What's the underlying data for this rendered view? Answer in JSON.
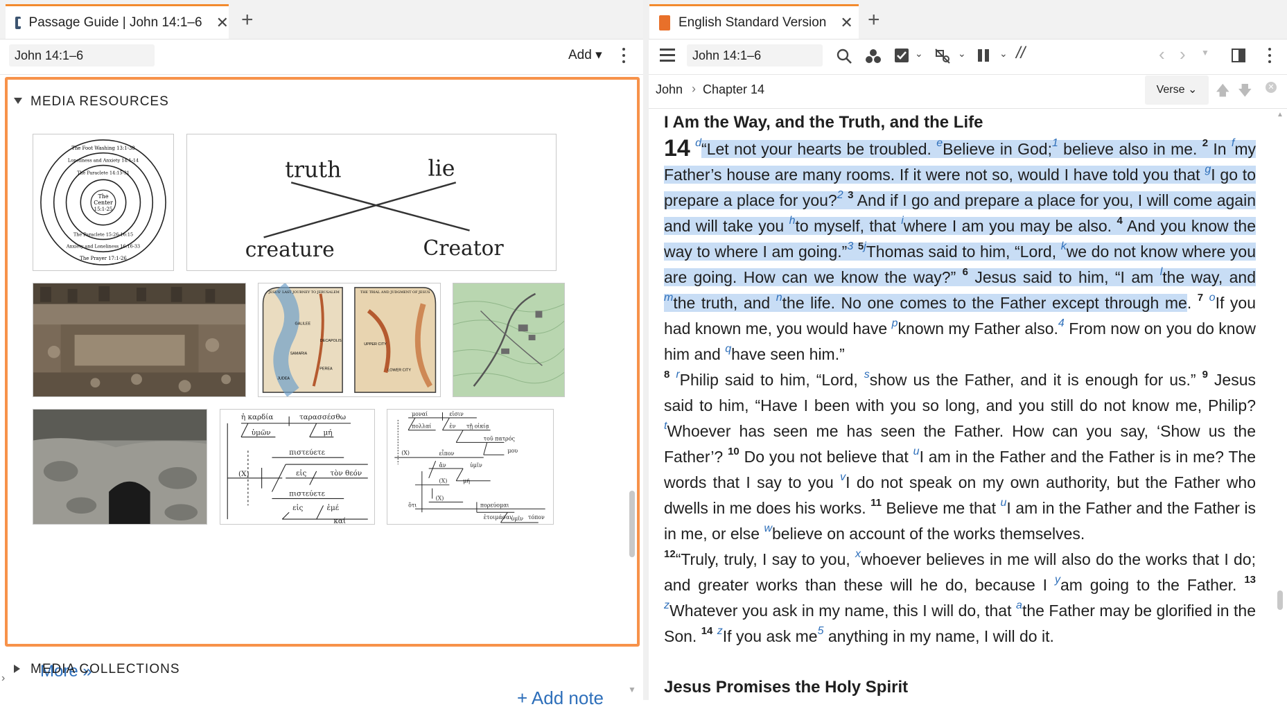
{
  "left": {
    "tab": {
      "title": "Passage Guide | John 14:1–6",
      "close": "✕",
      "add": "+"
    },
    "reference": "John 14:1–6",
    "add_button": "Add ▾",
    "media_resources": {
      "title": "MEDIA RESOURCES",
      "thumb1": {
        "ring_labels": [
          "The Foot Washing 13:1-38",
          "Loneliness and Anxiety 14:1-14",
          "The Paraclete 14:15-31",
          "The Paraclete 15:26-16:15",
          "Anxiety and Loneliness 16:16-33",
          "The Prayer 17:1-26"
        ],
        "center": [
          "The",
          "Center",
          "15:1-25"
        ]
      },
      "thumb2": {
        "words": [
          "truth",
          "lie",
          "creature",
          "Creator"
        ]
      },
      "thumb4": {
        "left_title": "JESUS' LAST JOURNEY TO JERUSALEM",
        "right_title": "THE TRIAL AND JUDGMENT OF JESUS",
        "places": [
          "GALILEE",
          "SAMARIA",
          "DECAPOLIS",
          "JUDEA",
          "PEREA",
          "UPPER CITY",
          "LOWER CITY"
        ]
      },
      "thumb7": {
        "words": [
          "ἡ καρδία",
          "ταρασσέσθω",
          "ὑμῶν",
          "μή",
          "πιστεύετε",
          "(X)",
          "εἰς",
          "τὸν θεόν",
          "πιστεύετε",
          "εἰς",
          "ἐμέ",
          "καί"
        ]
      },
      "thumb8": {
        "words": [
          "μοναί",
          "εἰσιν",
          "πολλαί",
          "ἐν",
          "τῇ οἰκίᾳ",
          "τοῦ πατρός",
          "μου",
          "(X)",
          "εἶπον",
          "ἄν",
          "ὑμῖν",
          "(X)",
          "μή",
          "ὅτι",
          "(X)",
          "πορεύομαι",
          "ἑτοιμάσαι",
          "τόπον",
          "ὑμῖν"
        ]
      },
      "more": "More »",
      "add_note": "+ Add note"
    },
    "media_collections": {
      "title": "MEDIA COLLECTIONS"
    }
  },
  "right": {
    "tab": {
      "title": "English Standard Version",
      "close": "✕",
      "add": "+"
    },
    "reference": "John 14:1–6",
    "breadcrumb": {
      "book": "John",
      "sep": "›",
      "chapter": "Chapter 14"
    },
    "verse_button": "Verse ⌄",
    "heading1": "I Am the Way, and the Truth, and the Life",
    "heading2": "Jesus Promises the Holy Spirit",
    "chapter_number": "14",
    "verses": {
      "v1_cr_d": "d",
      "v1_a": "“Let not your hearts be troubled. ",
      "v1_cr_e": "e",
      "v1_b": "Believe in God;",
      "v1_fn": "1",
      "v1_c": " believe also in me. ",
      "v2_num": "2",
      "v2_a": " In ",
      "v2_cr_f": "f",
      "v2_b": "my Father’s house are many rooms. If it were not so, would I have told you that ",
      "v2_cr_g": "g",
      "v2_c": "I go to prepare a place for you?",
      "v2_fn": "2",
      "v3_num": "3",
      "v3_a": " And if I go and prepare a place for you, I will come again and will take you ",
      "v3_cr_h": "h",
      "v3_b": "to myself, that ",
      "v3_cr_i": "i",
      "v3_c": "where I am you may be also. ",
      "v4_num": "4",
      "v4_a": " And you know the way to where I am going.”",
      "v4_fn": "3",
      "v5_num": "5",
      "v5_cr_j": "j",
      "v5_a": "Thomas said to him, “Lord, ",
      "v5_cr_k": "k",
      "v5_b": "we do not know where you are going. How can we know the way?” ",
      "v6_num": "6",
      "v6_a": " Jesus said to him, “I am ",
      "v6_cr_l": "l",
      "v6_b": "the way, and ",
      "v6_cr_m": "m",
      "v6_c": "the truth, and ",
      "v6_cr_n": "n",
      "v6_d": "the life. No one comes to the Father except through me",
      "v6_end": ". ",
      "v7_num": "7",
      "v7_cr_o": "o",
      "v7_a": "If you had known me, you would have ",
      "v7_cr_p": "p",
      "v7_b": "known my Father also.",
      "v7_fn": "4",
      "v7_c": " From now on you do know him and ",
      "v7_cr_q": "q",
      "v7_d": "have seen him.”",
      "v8_num": "8",
      "v8_cr_r": "r",
      "v8_a": "Philip said to him, “Lord, ",
      "v8_cr_s": "s",
      "v8_b": "show us the Father, and it is enough for us.” ",
      "v9_num": "9",
      "v9_a": " Jesus said to him, “Have I been with you so long, and you still do not know me, Philip? ",
      "v9_cr_t": "t",
      "v9_b": "Whoever has seen me has seen the Father. How can you say, ‘Show us the Father’? ",
      "v10_num": "10",
      "v10_a": " Do you not believe that ",
      "v10_cr_u": "u",
      "v10_b": "I am in the Father and the Father is in me? The words that I say to you ",
      "v10_cr_v": "v",
      "v10_c": "I do not speak on my own authority, but the Father who dwells in me does his works. ",
      "v11_num": "11",
      "v11_a": " Believe me that ",
      "v11_cr_u": "u",
      "v11_b": "I am in the Father and the Father is in me, or else ",
      "v11_cr_w": "w",
      "v11_c": "believe on account of the works themselves.",
      "v12_num": "12",
      "v12_a": "“Truly, truly, I say to you, ",
      "v12_cr_x": "x",
      "v12_b": "whoever believes in me will also do the works that I do; and greater works than these will he do, because I ",
      "v12_cr_y": "y",
      "v12_c": "am going to the Father. ",
      "v13_num": "13",
      "v13_cr_z": "z",
      "v13_a": "Whatever you ask in my name, this I will do, that ",
      "v13_cr_a": "a",
      "v13_b": "the Father may be glorified in the Son. ",
      "v14_num": "14",
      "v14_cr_z": "z",
      "v14_a": "If you ask me",
      "v14_fn": "5",
      "v14_b": " anything in my name, I will do it."
    }
  },
  "colors": {
    "accent_orange": "#f7924a",
    "link_blue": "#2e6fba",
    "highlight": "#c8ddf5"
  }
}
